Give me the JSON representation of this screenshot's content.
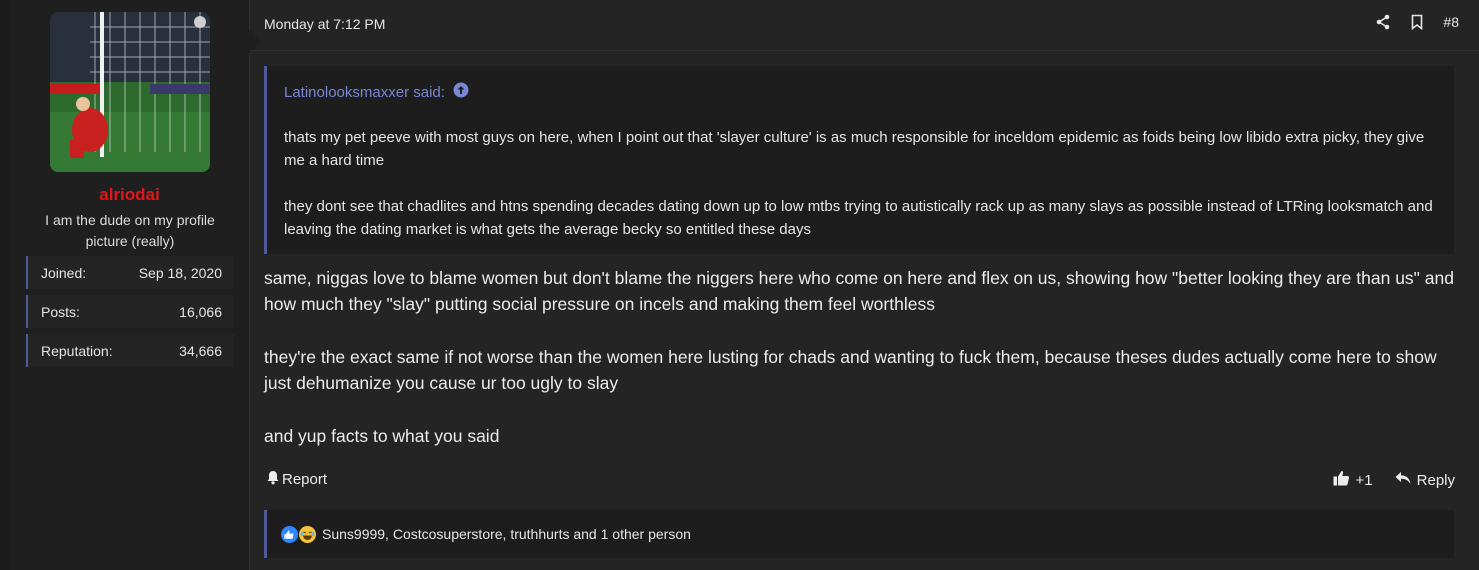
{
  "user": {
    "name": "alriodai",
    "title": "I am the dude on my profile picture (really)",
    "stats": [
      {
        "label": "Joined:",
        "value": "Sep 18, 2020"
      },
      {
        "label": "Posts:",
        "value": "16,066"
      },
      {
        "label": "Reputation:",
        "value": "34,666"
      }
    ]
  },
  "post": {
    "date": "Monday at 7:12 PM",
    "number": "#8",
    "quote": {
      "author": "Latinolooksmaxxer said:",
      "paragraphs": [
        "thats my pet peeve with most guys on here, when I point out that 'slayer culture' is as much responsible for inceldom epidemic as foids being low libido extra picky, they give me a hard time",
        "they dont see that chadlites and htns spending decades dating down up to low mtbs trying to autistically rack up as many slays as possible instead of LTRing looksmatch and leaving the dating market is what gets the average becky so entitled these days"
      ]
    },
    "body": [
      "same, niggas love to blame women but don't blame the niggers here who come on here and flex on us, showing how \"better looking they are than us\" and how much they \"slay\" putting social pressure on incels and making them feel worthless",
      "they're the exact same if not worse than the women here lusting for chads and wanting to fuck them, because theses dudes actually come here to show just dehumanize you cause ur too ugly to slay",
      "and yup facts to what you said"
    ],
    "actions": {
      "report": "Report",
      "like": "+1",
      "reply": "Reply"
    },
    "reactions": "Suns9999, Costcosuperstore, truthhurts and 1 other person"
  },
  "icons": [
    "share-icon",
    "bookmark-icon",
    "arrow-up-circle-icon",
    "bell-icon",
    "thumbs-up-icon",
    "reply-icon",
    "like-reaction-icon",
    "laugh-reaction-icon"
  ],
  "colors": {
    "accent": "#4f5a9a",
    "quote_author": "#7a86d6",
    "username": "#e0161b"
  }
}
